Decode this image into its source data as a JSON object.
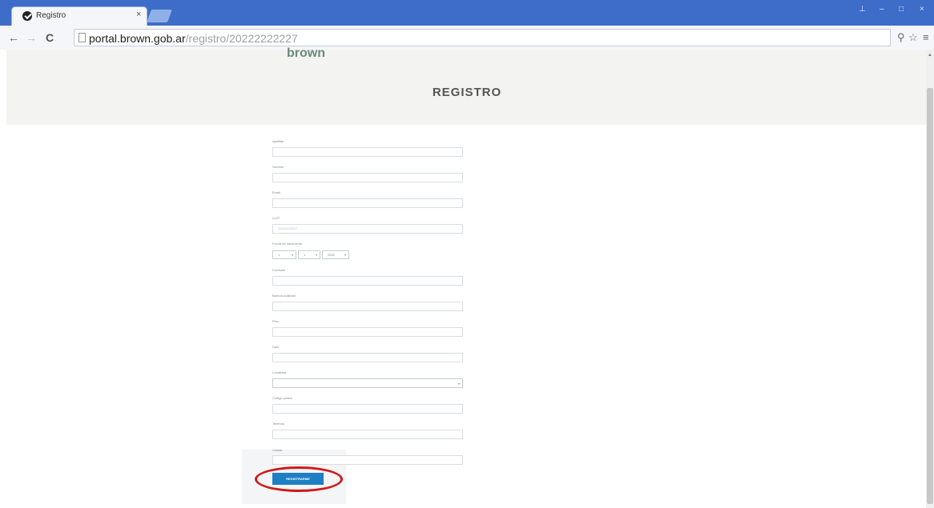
{
  "browser": {
    "tab_title": "Registro",
    "tab_close": "×",
    "url_host": "portal.brown.gob.ar",
    "url_path": "/registro/20222222227",
    "back": "←",
    "forward": "→",
    "reload": "C",
    "window_controls": [
      "⊥",
      "–",
      "□",
      "×"
    ],
    "right_icons": [
      "⚲",
      "☆",
      "≡"
    ]
  },
  "page": {
    "logo_text": "brown",
    "title": "REGISTRO"
  },
  "form": {
    "fields": [
      {
        "label": "Apellido",
        "value": ""
      },
      {
        "label": "Nombre",
        "value": ""
      },
      {
        "label": "Email",
        "value": ""
      },
      {
        "label": "CUIT",
        "value": "",
        "placeholder": "20222222227"
      },
      {
        "label": "Fecha de nacimiento",
        "day": "1",
        "month": "1",
        "year": "2000"
      },
      {
        "label": "Domicilio",
        "value": ""
      },
      {
        "label": "Barrio/Localidad",
        "value": ""
      },
      {
        "label": "Piso",
        "value": ""
      },
      {
        "label": "Dpto",
        "value": ""
      },
      {
        "label": "Localidad",
        "value": ""
      },
      {
        "label": "Codigo postal",
        "value": ""
      },
      {
        "label": "Telefono",
        "value": ""
      },
      {
        "label": "Celular",
        "value": ""
      }
    ],
    "submit_label": "REGISTRARME"
  }
}
